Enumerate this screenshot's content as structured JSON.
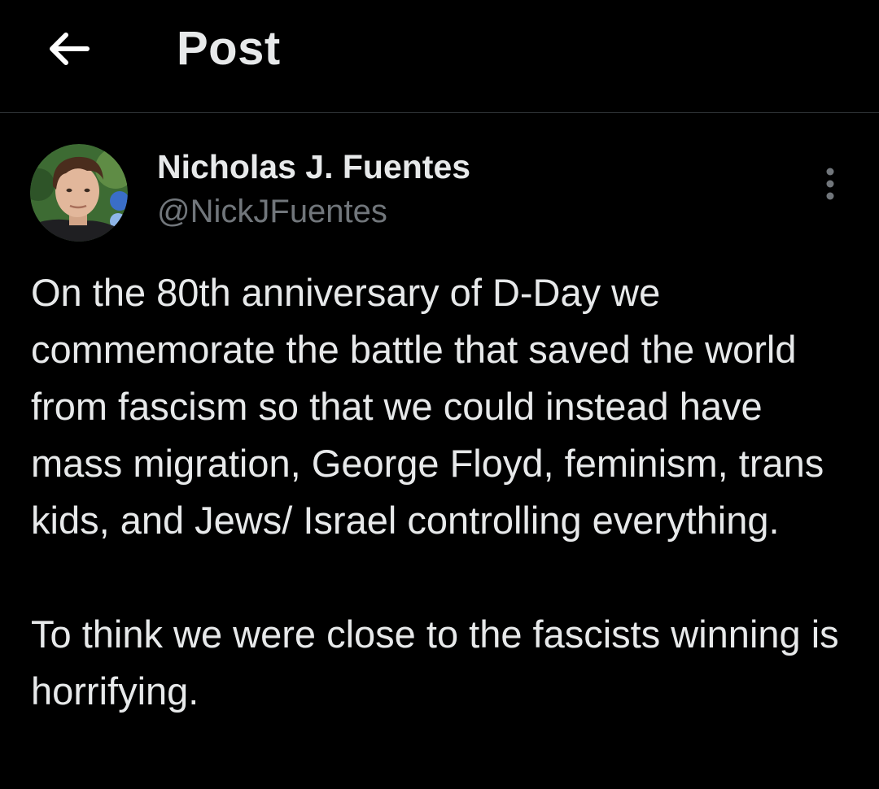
{
  "header": {
    "back_icon": "arrow-left-icon",
    "title": "Post"
  },
  "post": {
    "author": {
      "name": "Nicholas J. Fuentes",
      "handle": "@NickJFuentes",
      "avatar_icon": "user-avatar-photo"
    },
    "more_icon": "vertical-ellipsis-icon",
    "text": "On the 80th anniversary of D-Day we commemorate the battle that saved the world from fascism so that we could instead have mass migration, George Floyd, feminism, trans kids, and Jews/ Israel controlling everything.\n\nTo think we were close to the fascists winning is horrifying."
  },
  "colors": {
    "background": "#000000",
    "text_primary": "#e7e9ea",
    "text_secondary": "#71767b",
    "divider": "#2f3336"
  }
}
